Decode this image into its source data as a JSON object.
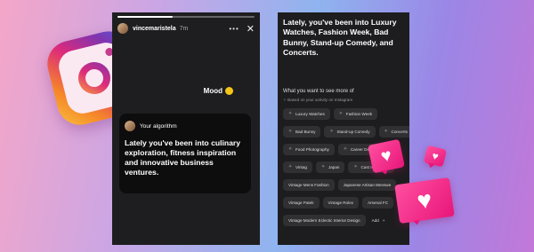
{
  "colors": {
    "instagram_gradient": [
      "#f9c23c",
      "#dd2a7b",
      "#8134af",
      "#515bd4"
    ],
    "heart_pink": "#ff4fa0",
    "phone_bg": "#1e1e20"
  },
  "story": {
    "username": "vincemaristela",
    "time": "7m",
    "menu_icon": "more-dots-icon",
    "close_icon": "close-icon",
    "mood": "Mood",
    "mood_emoji": "smiling-face-icon",
    "card": {
      "heading": "Your algorithm",
      "text": "Lately you've been into culinary exploration, fitness inspiration and innovative business ventures."
    }
  },
  "interests": {
    "title": "Lately, you've been into Luxury Watches, Fashion Week, Bad Bunny, Stand-up Comedy, and Concerts.",
    "prompt": "What you want to see more of",
    "subprompt": "Based on your activity on Instagram",
    "chip_icon": "sparkle-icon",
    "chips": [
      {
        "label": "Luxury Watches",
        "icon": true
      },
      {
        "label": "Fashion Week",
        "icon": true
      },
      {
        "label": "Bad Bunny",
        "icon": true
      },
      {
        "label": "Stand-up Comedy",
        "icon": true
      },
      {
        "label": "Concerts",
        "icon": true
      },
      {
        "label": "Food Photography",
        "icon": true
      },
      {
        "label": "Career Development",
        "icon": true
      },
      {
        "label": "Vintag",
        "icon": true
      },
      {
        "label": "Japan",
        "icon": true
      },
      {
        "label": "Cast Interviews",
        "icon": true
      },
      {
        "label": "Vintage Mens Fashion",
        "icon": false
      },
      {
        "label": "Japanese Artisan Menswe",
        "icon": false
      },
      {
        "label": "Vintage Patek",
        "icon": false
      },
      {
        "label": "Vintage Rolex",
        "icon": false
      },
      {
        "label": "Arsenal FC",
        "icon": false
      },
      {
        "label": "Vintage Modern Eclectic Interior Design",
        "icon": false
      }
    ],
    "add_label": "Add",
    "add_icon": "plus-icon"
  },
  "decorations": {
    "logo": "instagram-logo",
    "hearts": [
      "heart-icon",
      "heart-icon",
      "heart-icon"
    ]
  }
}
